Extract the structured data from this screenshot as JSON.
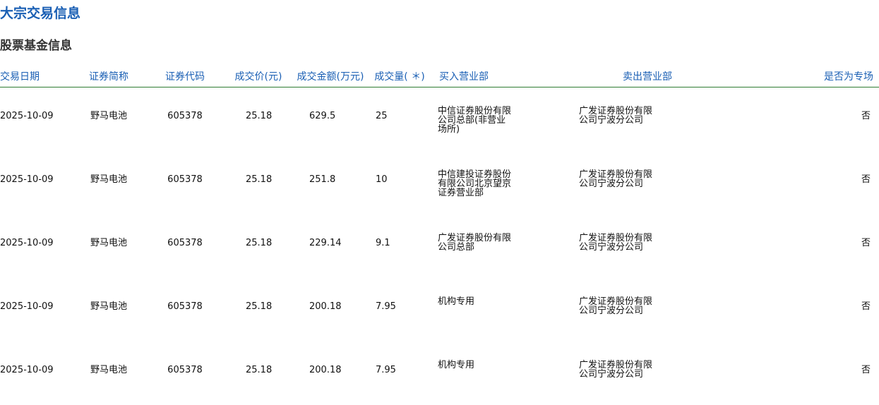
{
  "page": {
    "title": "大宗交易信息",
    "section_title": "股票基金信息"
  },
  "table": {
    "headers": {
      "date": "交易日期",
      "name": "证券简称",
      "code": "证券代码",
      "price": "成交价(元)",
      "amount": "成交金额(万元)",
      "volume": "成交量( ＊)",
      "buyer": "买入营业部",
      "seller": "卖出营业部",
      "special": "是否为专场"
    },
    "rows": [
      {
        "date": "2025-10-09",
        "name": "野马电池",
        "code": "605378",
        "price": "25.18",
        "amount": "629.5",
        "volume": "25",
        "buyer": "中信证券股份有限公司总部(非营业场所)",
        "seller": "广发证券股份有限公司宁波分公司",
        "special": "否"
      },
      {
        "date": "2025-10-09",
        "name": "野马电池",
        "code": "605378",
        "price": "25.18",
        "amount": "251.8",
        "volume": "10",
        "buyer": "中信建投证券股份有限公司北京望京证券营业部",
        "seller": "广发证券股份有限公司宁波分公司",
        "special": "否"
      },
      {
        "date": "2025-10-09",
        "name": "野马电池",
        "code": "605378",
        "price": "25.18",
        "amount": "229.14",
        "volume": "9.1",
        "buyer": "广发证券股份有限公司总部",
        "seller": "广发证券股份有限公司宁波分公司",
        "special": "否"
      },
      {
        "date": "2025-10-09",
        "name": "野马电池",
        "code": "605378",
        "price": "25.18",
        "amount": "200.18",
        "volume": "7.95",
        "buyer": "机构专用",
        "seller": "广发证券股份有限公司宁波分公司",
        "special": "否"
      },
      {
        "date": "2025-10-09",
        "name": "野马电池",
        "code": "605378",
        "price": "25.18",
        "amount": "200.18",
        "volume": "7.95",
        "buyer": "机构专用",
        "seller": "广发证券股份有限公司宁波分公司",
        "special": "否"
      }
    ]
  },
  "colors": {
    "title": "#1a5fb4",
    "section_title": "#333333",
    "header_text": "#1a5fb4",
    "header_rule": "#2e7d32"
  }
}
